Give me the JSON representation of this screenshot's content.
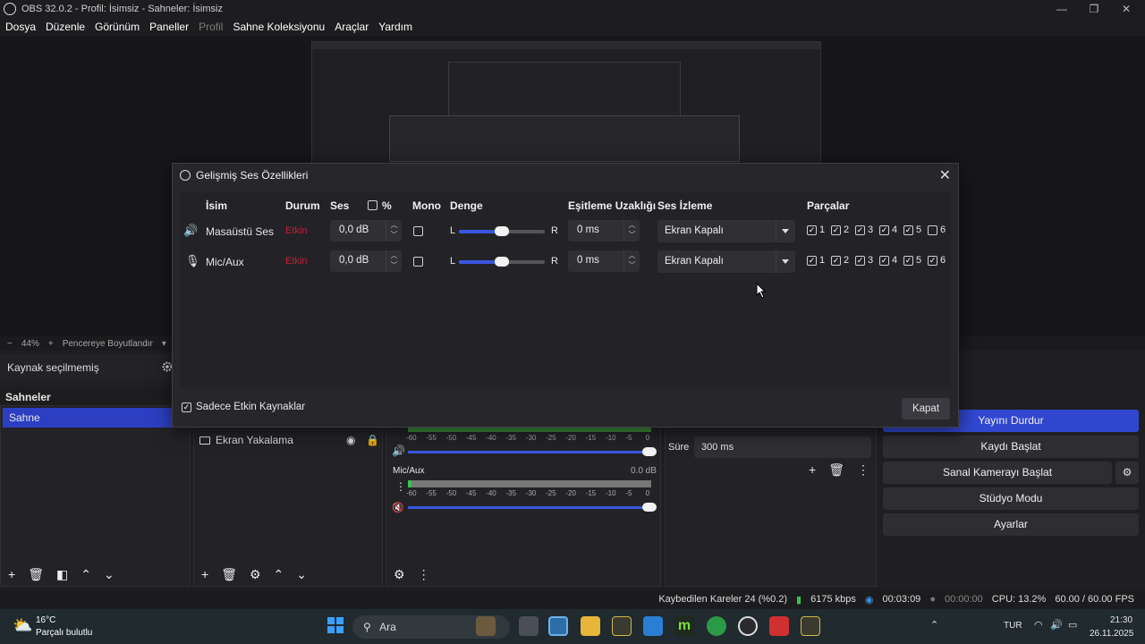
{
  "window": {
    "title": "OBS 32.0.2 - Profil: İsimsiz - Sahneler: İsimsiz",
    "controls": [
      "—",
      "❐",
      "✕"
    ]
  },
  "menu": [
    "Dosya",
    "Düzenle",
    "Görünüm",
    "Paneller",
    "Profil",
    "Sahne Koleksiyonu",
    "Araçlar",
    "Yardım"
  ],
  "zoom": {
    "minus": "−",
    "level": "44%",
    "plus": "+",
    "fit": "Pencereye Boyutlandır"
  },
  "source_bar": {
    "label": "Kaynak seçilmemiş"
  },
  "scenes": {
    "title": "Sahneler",
    "items": [
      "Sahne"
    ]
  },
  "sources": {
    "items": [
      {
        "name": "Ekran Yakalama"
      }
    ]
  },
  "mixer": {
    "mic_label": "Mic/Aux",
    "mic_db": "0.0 dB",
    "ticks": [
      "-60",
      "-55",
      "-50",
      "-45",
      "-40",
      "-35",
      "-30",
      "-25",
      "-20",
      "-15",
      "-10",
      "-5",
      "0"
    ]
  },
  "transitions": {
    "duration_label": "Süre",
    "duration_value": "300 ms"
  },
  "controls": {
    "buttons": [
      "Yayını Durdur",
      "Kaydı Başlat",
      "Sanal Kamerayı Başlat",
      "Stüdyo Modu",
      "Ayarlar"
    ]
  },
  "status": {
    "dropped": "Kaybedilen Kareler 24 (%0.2)",
    "bitrate": "6175 kbps",
    "stream_time": "00:03:09",
    "rec_time": "00:00:00",
    "cpu": "CPU: 13.2%",
    "fps": "60.00 / 60.00 FPS"
  },
  "dialog": {
    "title": "Gelişmiş Ses Özellikleri",
    "headers": {
      "name": "İsim",
      "status": "Durum",
      "volume": "Ses",
      "percent": "%",
      "mono": "Mono",
      "balance": "Denge",
      "sync": "Eşitleme Uzaklığı",
      "monitoring": "Ses İzleme",
      "tracks": "Parçalar"
    },
    "rows": [
      {
        "name": "Masaüstü Ses",
        "status": "Etkin",
        "volume": "0,0 dB",
        "balance_l": "L",
        "balance_r": "R",
        "balance": 0.5,
        "sync": "0 ms",
        "monitoring": "Ekran Kapalı",
        "tracks": [
          true,
          true,
          true,
          true,
          true,
          false
        ]
      },
      {
        "name": "Mic/Aux",
        "status": "Etkin",
        "volume": "0,0 dB",
        "balance_l": "L",
        "balance_r": "R",
        "balance": 0.5,
        "sync": "0 ms",
        "monitoring": "Ekran Kapalı",
        "tracks": [
          true,
          true,
          true,
          true,
          true,
          true
        ]
      }
    ],
    "track_numbers": [
      "1",
      "2",
      "3",
      "4",
      "5",
      "6"
    ],
    "footer_checkbox": "Sadece Etkin Kaynaklar",
    "close_button": "Kapat"
  },
  "taskbar": {
    "weather_temp": "16°C",
    "weather_desc": "Parçalı bulutlu",
    "search": "Ara",
    "lang": "TUR",
    "time": "21:30",
    "date": "26.11.2025"
  },
  "colors": {
    "accent": "#3147d0",
    "status_red": "#c0203a",
    "green": "#33c353"
  }
}
